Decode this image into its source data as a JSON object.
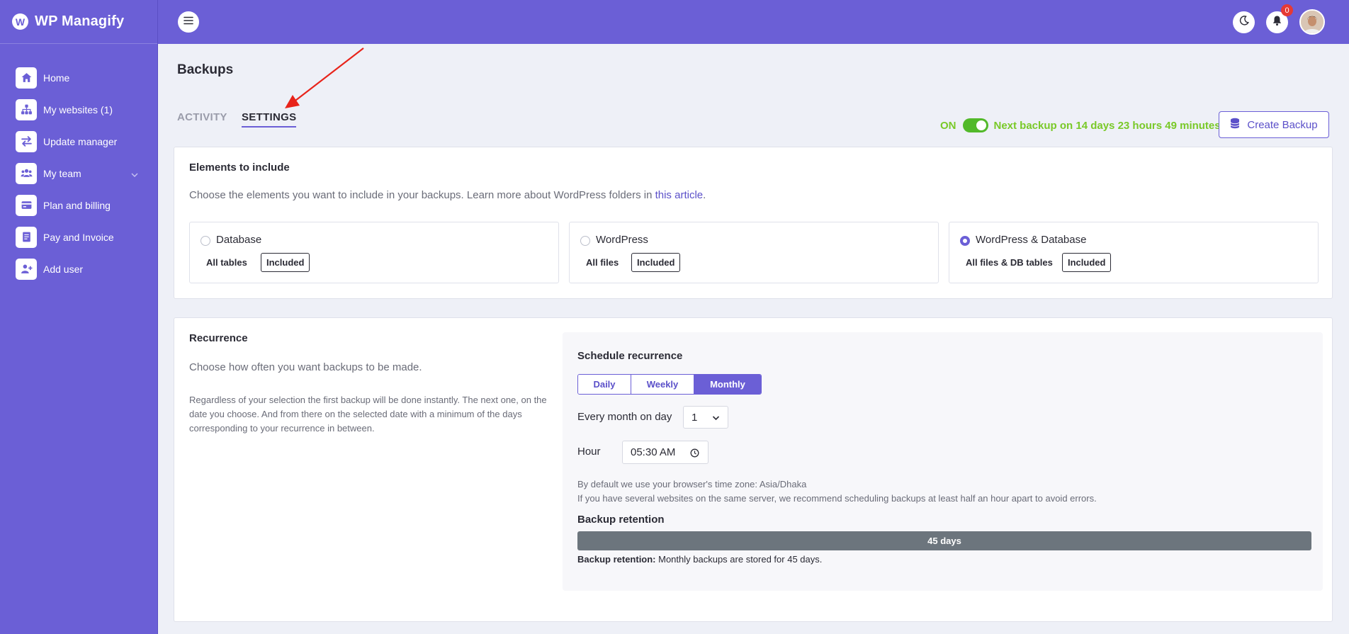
{
  "brand": {
    "name": "WP Managify",
    "logo_letter": "W"
  },
  "sidebar": {
    "items": [
      {
        "label": "Home",
        "icon": "home-icon"
      },
      {
        "label": "My websites (1)",
        "icon": "sitemap-icon"
      },
      {
        "label": "Update manager",
        "icon": "swap-arrows-icon"
      },
      {
        "label": "My team",
        "icon": "team-icon"
      },
      {
        "label": "Plan and billing",
        "icon": "credit-card-icon"
      },
      {
        "label": "Pay and Invoice",
        "icon": "invoice-icon"
      },
      {
        "label": "Add user",
        "icon": "add-user-icon"
      }
    ]
  },
  "topbar": {
    "notification_count": "0"
  },
  "page": {
    "title": "Backups",
    "tabs": {
      "activity": "ACTIVITY",
      "settings": "SETTINGS"
    },
    "status": {
      "on": "ON",
      "next_backup": "Next backup on 14 days 23 hours 49 minutes"
    },
    "create_backup": "Create Backup"
  },
  "elements": {
    "heading": "Elements to include",
    "intro_text": "Choose the elements you want to include in your backups. Learn more about WordPress folders in ",
    "intro_link": "this article",
    "intro_end": ".",
    "options": [
      {
        "title": "Database",
        "sub": "All tables",
        "badge": "Included",
        "selected": false
      },
      {
        "title": "WordPress",
        "sub": "All files",
        "badge": "Included",
        "selected": false
      },
      {
        "title": "WordPress & Database",
        "sub": "All files & DB tables",
        "badge": "Included",
        "selected": true
      }
    ]
  },
  "recurrence": {
    "heading": "Recurrence",
    "intro": "Choose how often you want backups to be made.",
    "note": "Regardless of your selection the first backup will be done instantly. The next one, on the date you choose. And from there on the selected date with a minimum of the days corresponding to your recurrence in between.",
    "schedule": {
      "title": "Schedule recurrence",
      "options": [
        "Daily",
        "Weekly",
        "Monthly"
      ],
      "active": "Monthly",
      "day_label": "Every month on day",
      "day_value": "1",
      "hour_label": "Hour",
      "hour_value": "05:30 AM",
      "tz_note": "By default we use your browser's time zone: Asia/Dhaka",
      "server_note": "If you have several websites on the same server, we recommend scheduling backups at least half an hour apart to avoid errors."
    },
    "retention": {
      "title": "Backup retention",
      "value": "45 days",
      "note_label": "Backup retention:",
      "note_text": " Monthly backups are stored for 45 days."
    }
  },
  "colors": {
    "brand": "#6b5fd6",
    "success": "#79c928",
    "retention_bar": "#6c757d",
    "annotation_arrow": "#e8231a"
  }
}
